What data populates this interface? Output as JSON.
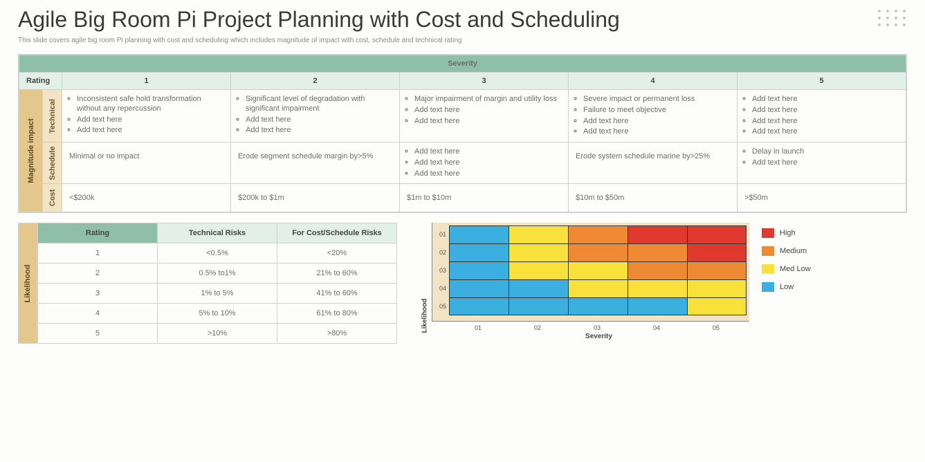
{
  "title": "Agile Big Room Pi Project Planning with Cost and Scheduling",
  "subtitle": "This slide covers agile big room Pi planning with cost and scheduling which includes magnitude of impact with cost, schedule and technical rating",
  "severity": {
    "header": "Severity",
    "rating_label": "Rating",
    "columns": [
      "1",
      "2",
      "3",
      "4",
      "5"
    ],
    "magnitude_label": "Magnitude impact",
    "rows": [
      {
        "label": "Technical",
        "cells": [
          [
            "Inconsistent safe hold transformation without any repercussion",
            "Add text here",
            "Add text here"
          ],
          [
            "Significant level of degradation with significant impairment",
            "Add text here",
            "Add text here"
          ],
          [
            "Major impairment of margin and utility loss",
            "Add text here",
            "Add text here"
          ],
          [
            "Severe impact or permanent loss",
            "Failure to meet objective",
            "Add text here",
            "Add text here"
          ],
          [
            "Add text here",
            "Add text here",
            "Add text here",
            "Add text here"
          ]
        ]
      },
      {
        "label": "Schedule",
        "cells": [
          "Minimal or no impact",
          "Erode segment schedule margin by>5%",
          [
            "Add text here",
            "Add text here",
            "Add text here"
          ],
          "Erode system schedule marine by>25%",
          [
            "Delay in launch",
            "Add text here"
          ]
        ]
      },
      {
        "label": "Cost",
        "cells": [
          "<$200k",
          "$200k to $1m",
          "$1m to $10m",
          "$10m to $50m",
          ">$50m"
        ]
      }
    ]
  },
  "likelihood": {
    "vlabel": "Likelihood",
    "headers": [
      "Rating",
      "Technical Risks",
      "For Cost/Schedule Risks"
    ],
    "rows": [
      [
        "1",
        "<0.5%",
        "<20%"
      ],
      [
        "2",
        "0.5% to1%",
        "21% to 60%"
      ],
      [
        "3",
        "1% to 5%",
        "41% to 60%"
      ],
      [
        "4",
        "5% to 10%",
        "61% to 80%"
      ],
      [
        "5",
        ">10%",
        ">80%"
      ]
    ]
  },
  "chart_data": {
    "type": "heatmap",
    "xlabel": "Severity",
    "ylabel": "Likelihood",
    "x_categories": [
      "01",
      "02",
      "03",
      "04",
      "05"
    ],
    "y_categories": [
      "01",
      "02",
      "03",
      "04",
      "05"
    ],
    "level_scale": [
      "Low",
      "Med Low",
      "Medium",
      "High"
    ],
    "level_colors": {
      "High": "#e03a2f",
      "Medium": "#ee8a33",
      "Med Low": "#f7e13a",
      "Low": "#3bb0e0"
    },
    "matrix_levels": [
      [
        "Low",
        "Med Low",
        "Medium",
        "High",
        "High"
      ],
      [
        "Low",
        "Med Low",
        "Medium",
        "Medium",
        "High"
      ],
      [
        "Low",
        "Med Low",
        "Med Low",
        "Medium",
        "Medium"
      ],
      [
        "Low",
        "Low",
        "Med Low",
        "Med Low",
        "Med Low"
      ],
      [
        "Low",
        "Low",
        "Low",
        "Low",
        "Med Low"
      ]
    ],
    "legend": [
      {
        "label": "High",
        "color": "#e03a2f"
      },
      {
        "label": "Medium",
        "color": "#ee8a33"
      },
      {
        "label": "Med Low",
        "color": "#f7e13a"
      },
      {
        "label": "Low",
        "color": "#3bb0e0"
      }
    ]
  }
}
